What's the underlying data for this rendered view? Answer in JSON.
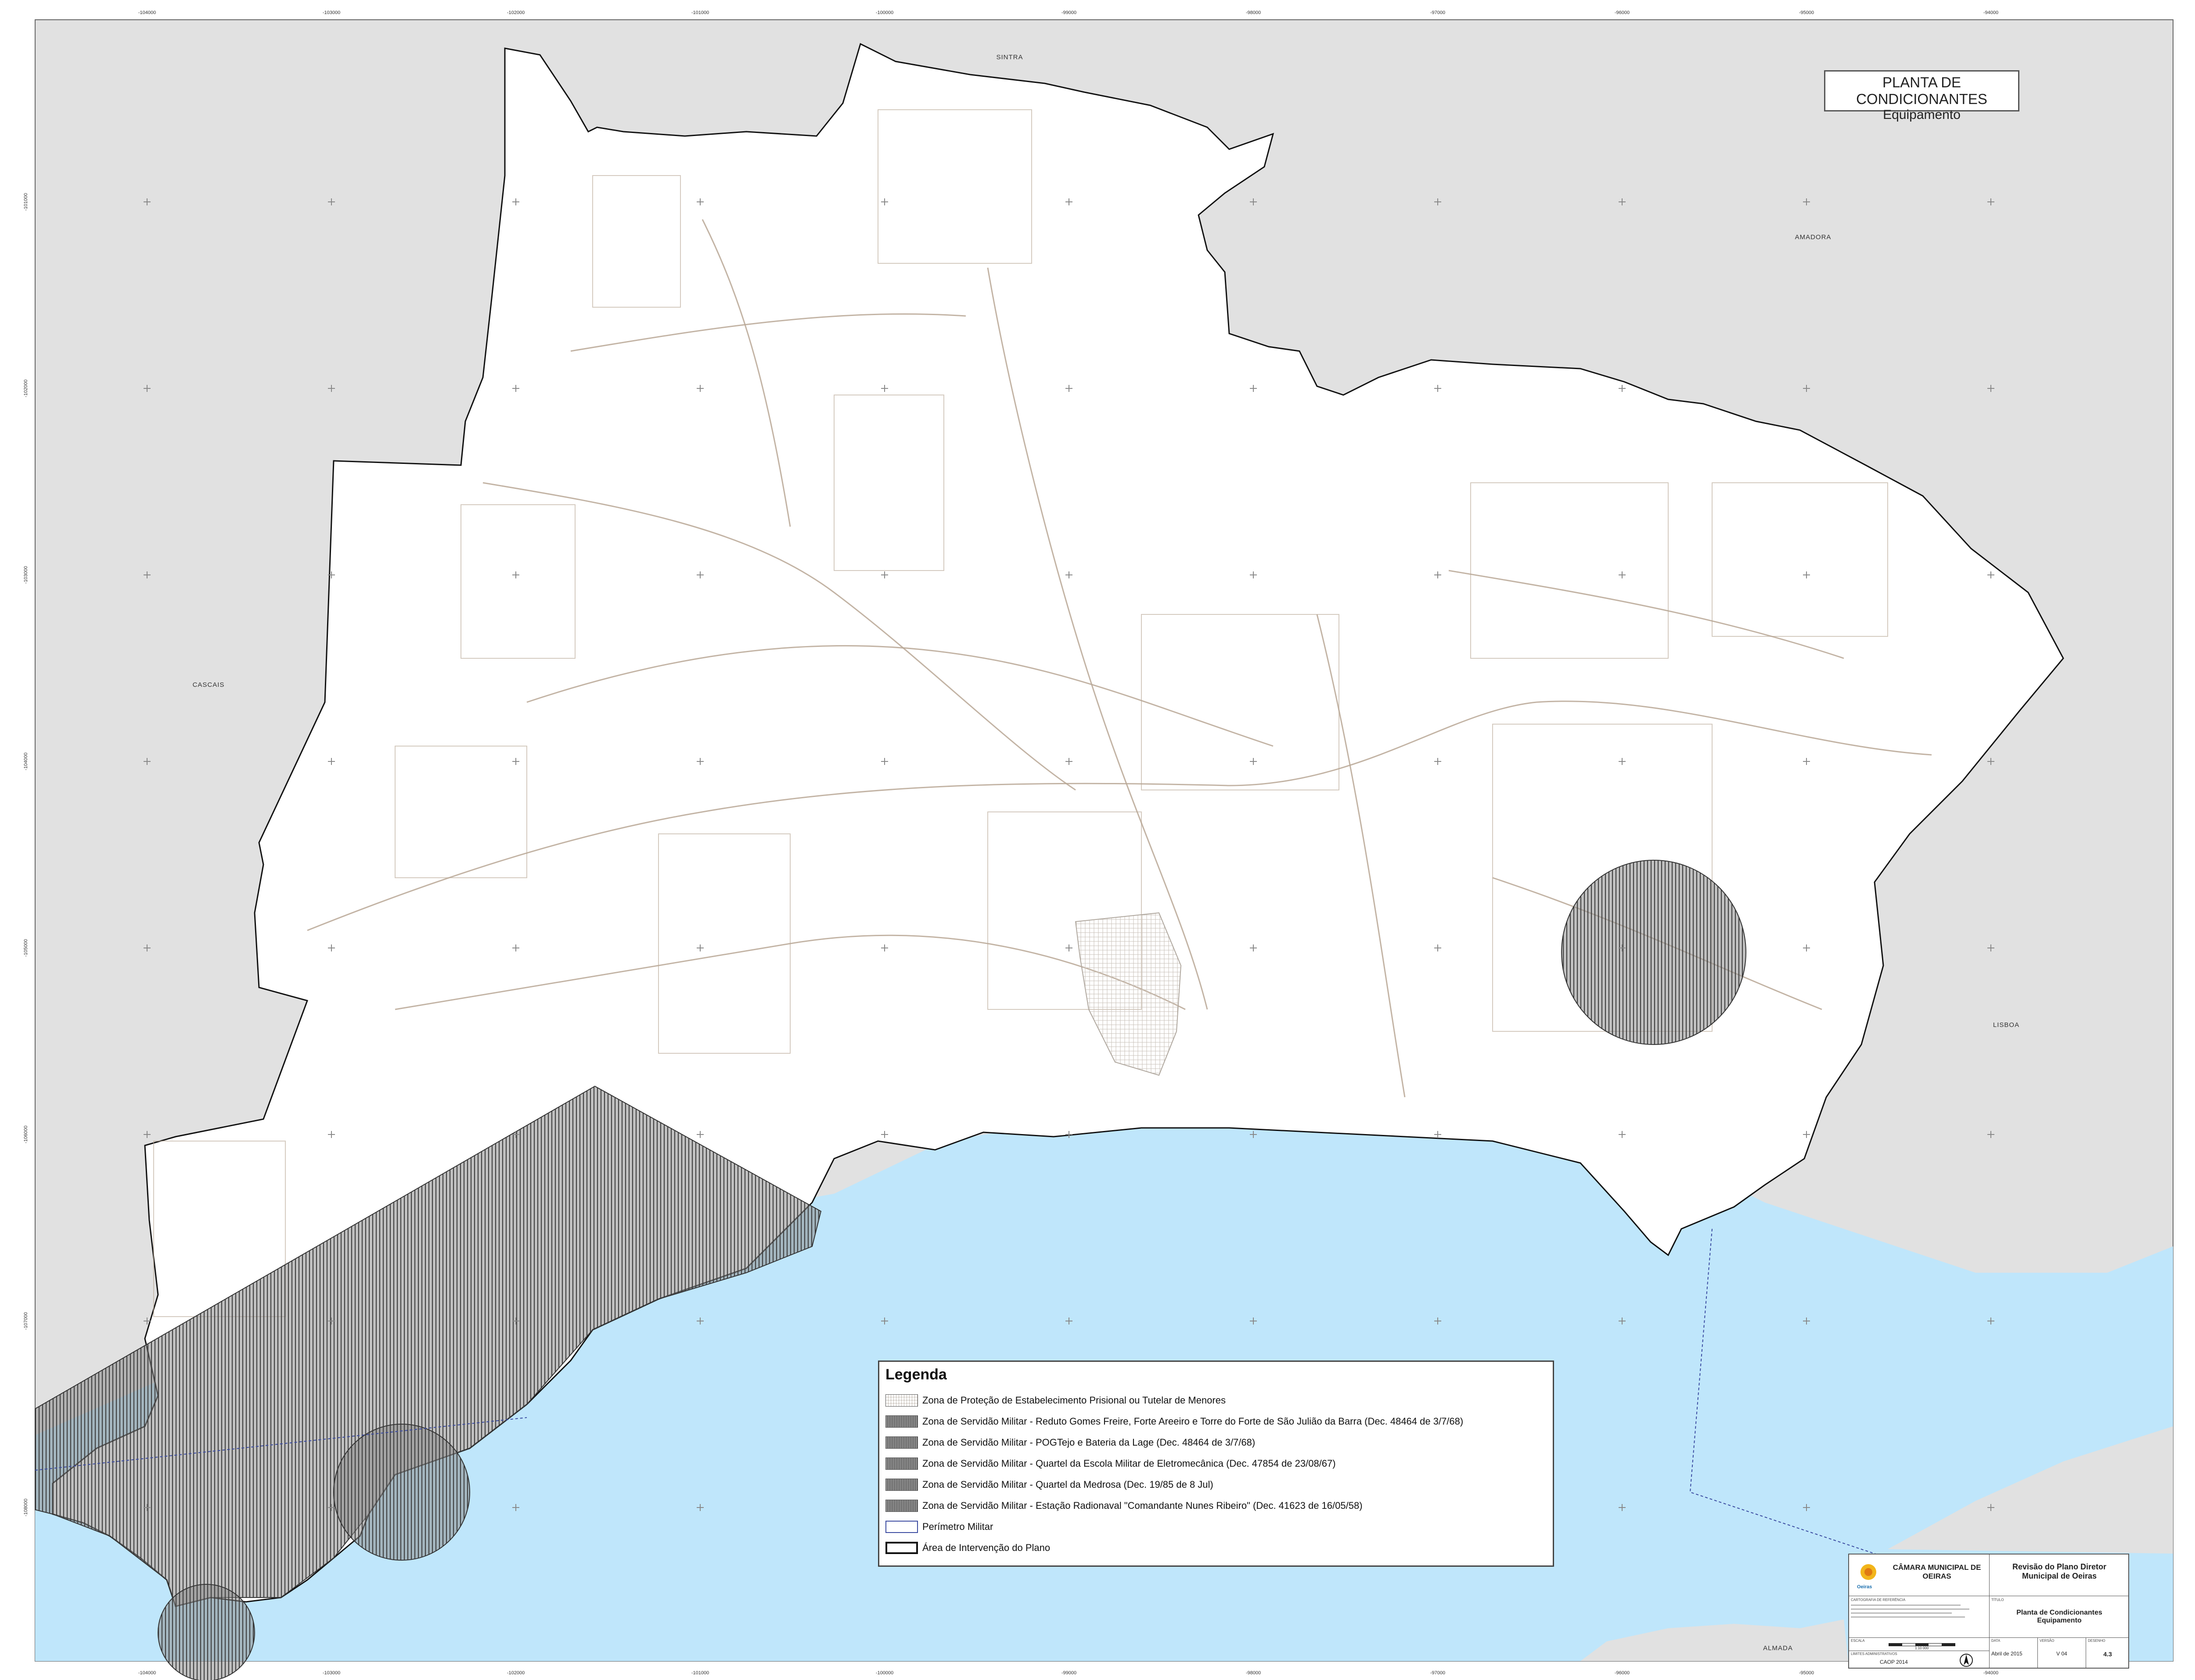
{
  "title": {
    "line1": "PLANTA DE CONDICIONANTES",
    "line2": "Equipamento"
  },
  "places": {
    "sintra": "SINTRA",
    "amadora": "AMADORA",
    "cascais": "CASCAIS",
    "lisboa": "LISBOA",
    "almada": "ALMADA"
  },
  "grid_labels": {
    "top": [
      "-104000",
      "-103000",
      "-102000",
      "-101000",
      "-100000",
      "-99000",
      "-98000",
      "-97000",
      "-96000",
      "-95000",
      "-94000"
    ],
    "left": [
      "-101000",
      "-102000",
      "-103000",
      "-104000",
      "-105000",
      "-106000",
      "-107000",
      "-108000",
      "-109000"
    ]
  },
  "legend": {
    "title": "Legenda",
    "items": [
      {
        "label": "Zona de Proteção de Estabelecimento Prisional ou Tutelar de Menores",
        "swatch": "hatch-light"
      },
      {
        "label": "Zona de Servidão Militar - Reduto Gomes Freire, Forte Areeiro e Torre do Forte de São Julião da Barra (Dec. 48464 de 3/7/68)",
        "swatch": "hatch-dark"
      },
      {
        "label": "Zona de Servidão Militar - POGTejo e Bateria da Lage (Dec. 48464 de 3/7/68)",
        "swatch": "hatch-dark"
      },
      {
        "label": "Zona de Servidão Militar - Quartel da Escola Militar de Eletromecânica (Dec. 47854 de 23/08/67)",
        "swatch": "hatch-dark"
      },
      {
        "label": "Zona de Servidão Militar - Quartel da Medrosa (Dec. 19/85 de 8 Jul)",
        "swatch": "hatch-dark"
      },
      {
        "label": "Zona de Servidão Militar - Estação Radionaval \"Comandante Nunes Ribeiro\" (Dec. 41623 de 16/05/58)",
        "swatch": "hatch-dark"
      },
      {
        "label": "Perímetro Militar",
        "swatch": "outline-blue"
      },
      {
        "label": "Área de Intervenção do Plano",
        "swatch": "outline-black"
      }
    ]
  },
  "cartouche": {
    "municipality": "CÂMARA MUNICIPAL DE OEIRAS",
    "logo_text": "Oeiras",
    "project": "Revisão do Plano Diretor Municipal de Oeiras",
    "sheet_title": "Planta de Condicionantes Equipamento",
    "base_label": "CARTOGRAFIA DE REFERÊNCIA",
    "limits_label": "LIMITES ADMINISTRATIVOS",
    "limits_value": "CAOP 2014",
    "scale_label": "ESCALA",
    "scale_value": "1:10 000",
    "date_label": "DATA",
    "date_value": "Abril de 2015",
    "version_label": "VERSÃO",
    "version_value": "V 04",
    "drawing_label": "DESENHO",
    "drawing_value": "4.3",
    "title_label": "TÍTULO"
  },
  "colors": {
    "water": "#bfe6fb",
    "neighbour": "#e1e1e1",
    "road": "#b8a795",
    "hatch": "#4d4d4d",
    "border": "#111111"
  }
}
